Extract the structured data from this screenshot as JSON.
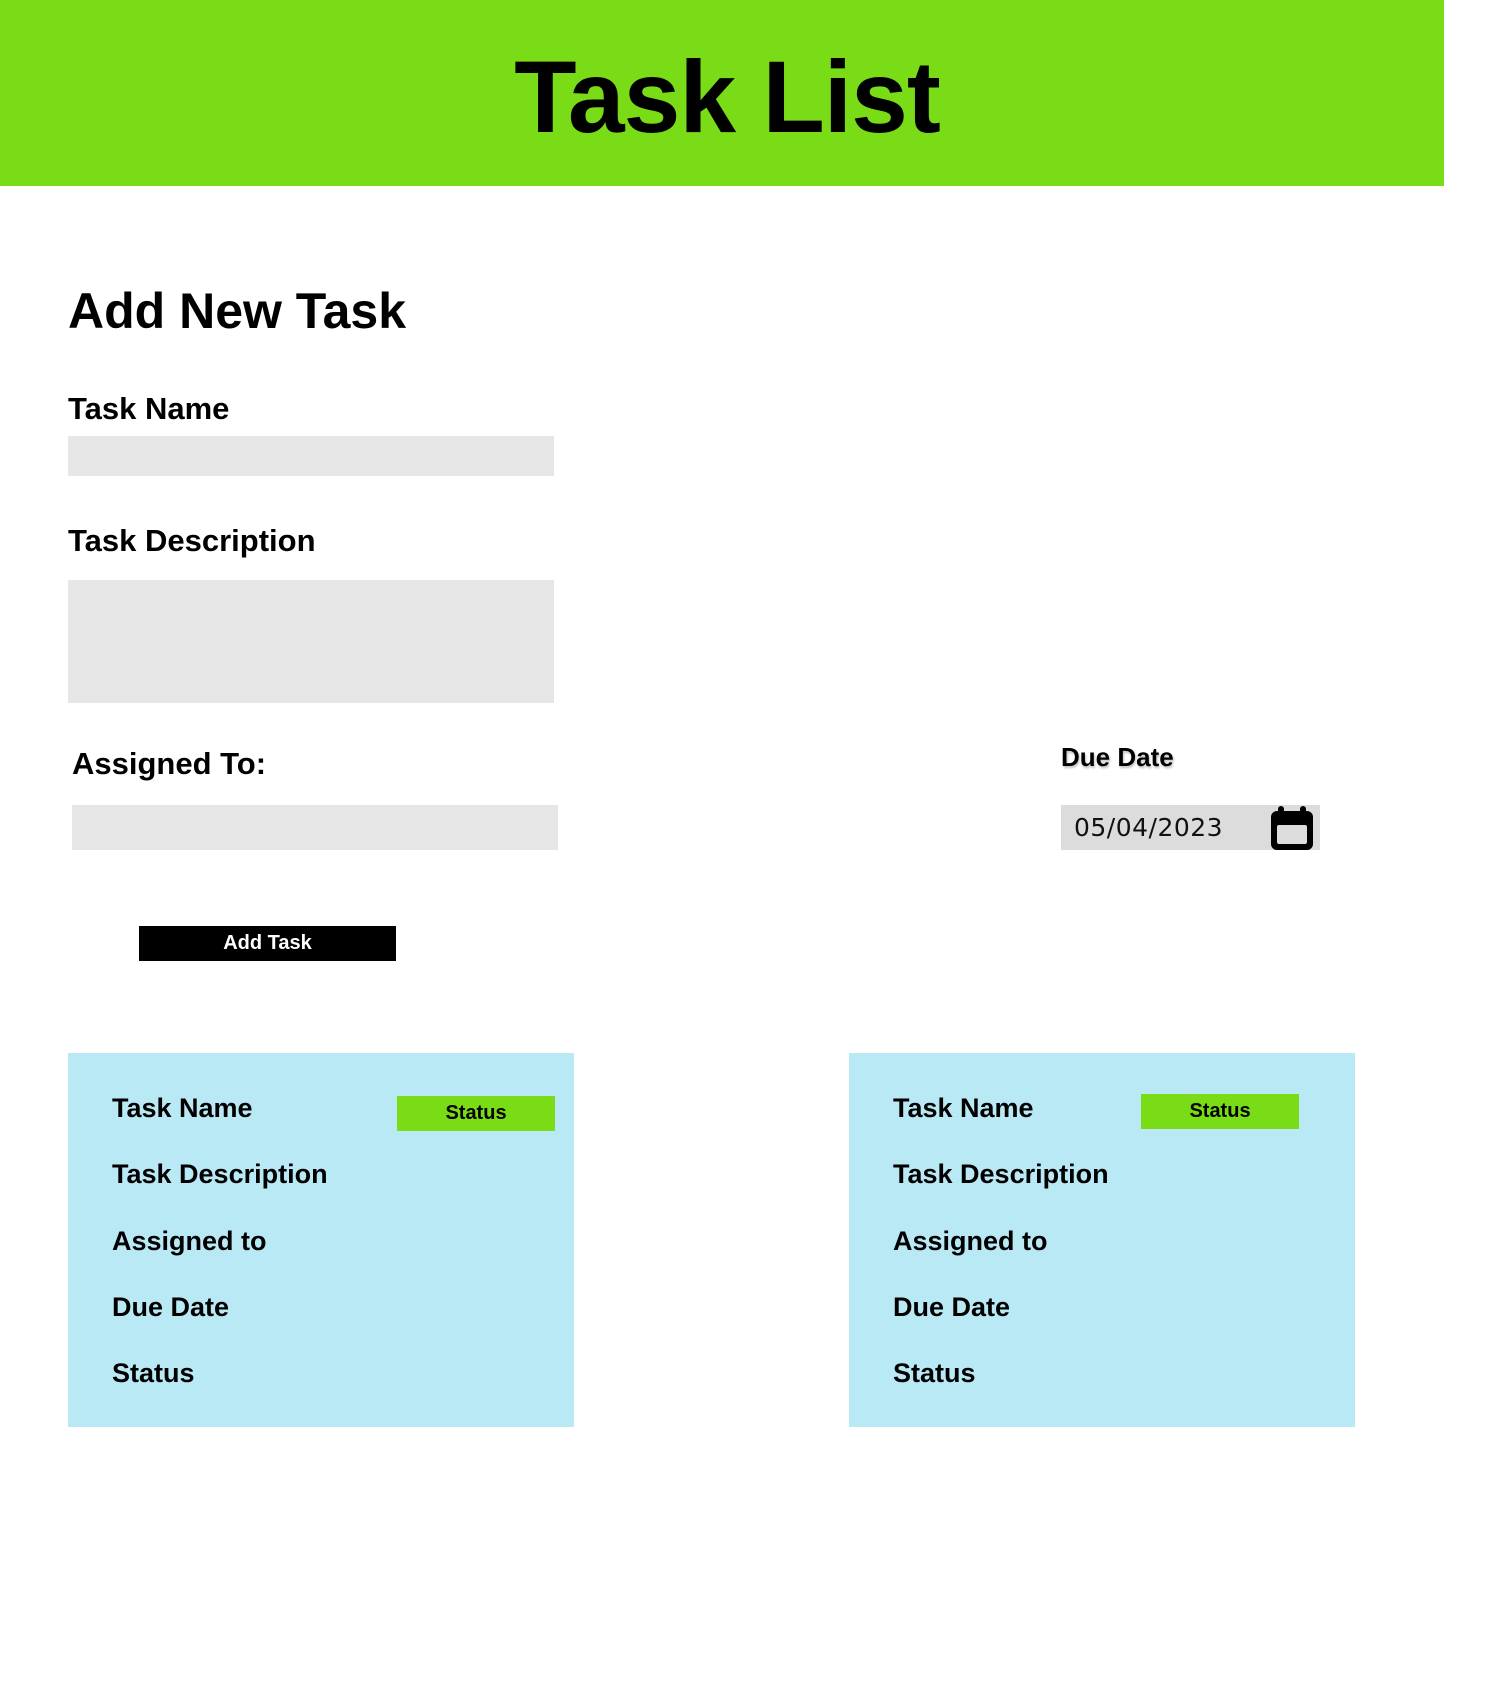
{
  "header": {
    "title": "Task List"
  },
  "form": {
    "section_title": "Add New Task",
    "task_name_label": "Task Name",
    "task_name_value": "",
    "task_description_label": "Task Description",
    "task_description_value": "",
    "assigned_to_label": "Assigned To:",
    "assigned_to_value": "",
    "due_date_label": "Due Date",
    "due_date_value": "05/04/2023",
    "due_date_icon": "calendar-icon",
    "submit_label": "Add Task"
  },
  "cards": [
    {
      "status_badge": "Status",
      "task_name": "Task Name",
      "task_description": "Task Description",
      "assigned_to": "Assigned to",
      "due_date": "Due Date",
      "status": "Status"
    },
    {
      "status_badge": "Status",
      "task_name": "Task Name",
      "task_description": "Task Description",
      "assigned_to": "Assigned to",
      "due_date": "Due Date",
      "status": "Status"
    }
  ],
  "colors": {
    "header_bg": "#79dc16",
    "card_bg": "#b9e9f5",
    "status_badge_bg": "#79dc16",
    "input_bg": "#e6e6e6",
    "button_bg": "#000000"
  }
}
